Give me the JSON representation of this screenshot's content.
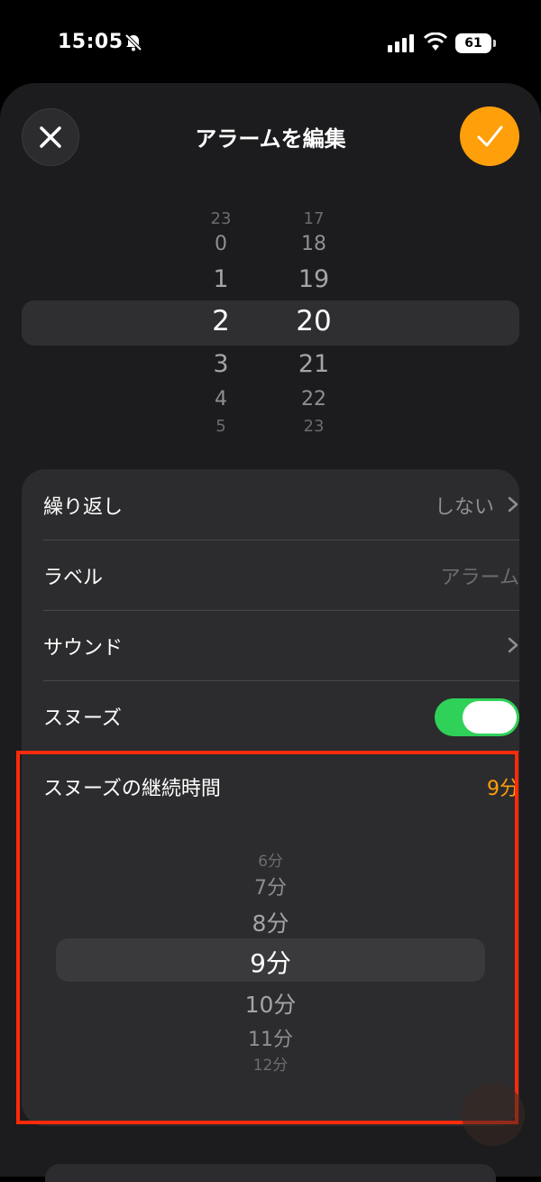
{
  "status_bar": {
    "time": "15:05",
    "battery": "61",
    "icons": [
      "bell-slash-icon",
      "signal-icon",
      "wifi-icon",
      "battery-icon"
    ]
  },
  "header": {
    "title": "アラームを編集",
    "close_icon": "close-icon",
    "confirm_icon": "checkmark-icon"
  },
  "time_picker": {
    "hours": [
      "23",
      "0",
      "1",
      "2",
      "3",
      "4",
      "5"
    ],
    "minutes": [
      "17",
      "18",
      "19",
      "20",
      "21",
      "22",
      "23"
    ],
    "selected_hour": "2",
    "selected_minute": "20"
  },
  "settings": {
    "repeat": {
      "label": "繰り返し",
      "value": "しない"
    },
    "label": {
      "label": "ラベル",
      "placeholder": "アラーム"
    },
    "sound": {
      "label": "サウンド"
    },
    "snooze": {
      "label": "スヌーズ",
      "enabled": true
    },
    "snooze_duration": {
      "label": "スヌーズの継続時間",
      "value": "9分"
    }
  },
  "snooze_picker": {
    "options": [
      "6分",
      "7分",
      "8分",
      "9分",
      "10分",
      "11分",
      "12分"
    ],
    "selected": "9分"
  },
  "colors": {
    "accent": "#ff9f0a",
    "toggle_on": "#30d158",
    "annotation": "#ff2a0a"
  }
}
